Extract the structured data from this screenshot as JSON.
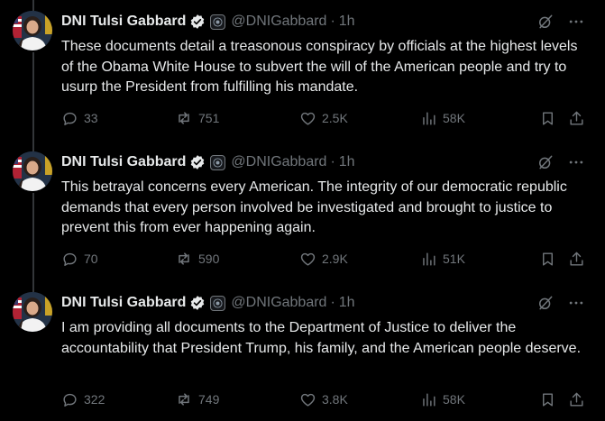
{
  "colors": {
    "background": "#000000",
    "text": "#e7e9ea",
    "muted": "#71767b",
    "verified_blue": "#1d9bf0",
    "thread_line": "#333639"
  },
  "tweets": [
    {
      "author": {
        "name": "DNI Tulsi Gabbard",
        "handle": "@DNIGabbard",
        "verified": "verified-badge-icon",
        "affiliation": "government-seal-icon"
      },
      "separator": "·",
      "time": "1h",
      "text": "These documents detail a treasonous conspiracy by officials at the highest levels of the Obama White House to subvert the will of the American people and try to usurp the President from fulfilling his mandate.",
      "metrics": {
        "replies": "33",
        "reposts": "751",
        "likes": "2.5K",
        "views": "58K"
      }
    },
    {
      "author": {
        "name": "DNI Tulsi Gabbard",
        "handle": "@DNIGabbard",
        "verified": "verified-badge-icon",
        "affiliation": "government-seal-icon"
      },
      "separator": "·",
      "time": "1h",
      "text": "This betrayal concerns every American. The integrity of our democratic republic demands that every person involved be investigated and brought to justice to prevent this from ever happening again.",
      "metrics": {
        "replies": "70",
        "reposts": "590",
        "likes": "2.9K",
        "views": "51K"
      }
    },
    {
      "author": {
        "name": "DNI Tulsi Gabbard",
        "handle": "@DNIGabbard",
        "verified": "verified-badge-icon",
        "affiliation": "government-seal-icon"
      },
      "separator": "·",
      "time": "1h",
      "text": "I am providing all documents to the Department of Justice to deliver the accountability that President Trump, his family, and the American people deserve.",
      "metrics": {
        "replies": "322",
        "reposts": "749",
        "likes": "3.8K",
        "views": "58K"
      }
    }
  ]
}
